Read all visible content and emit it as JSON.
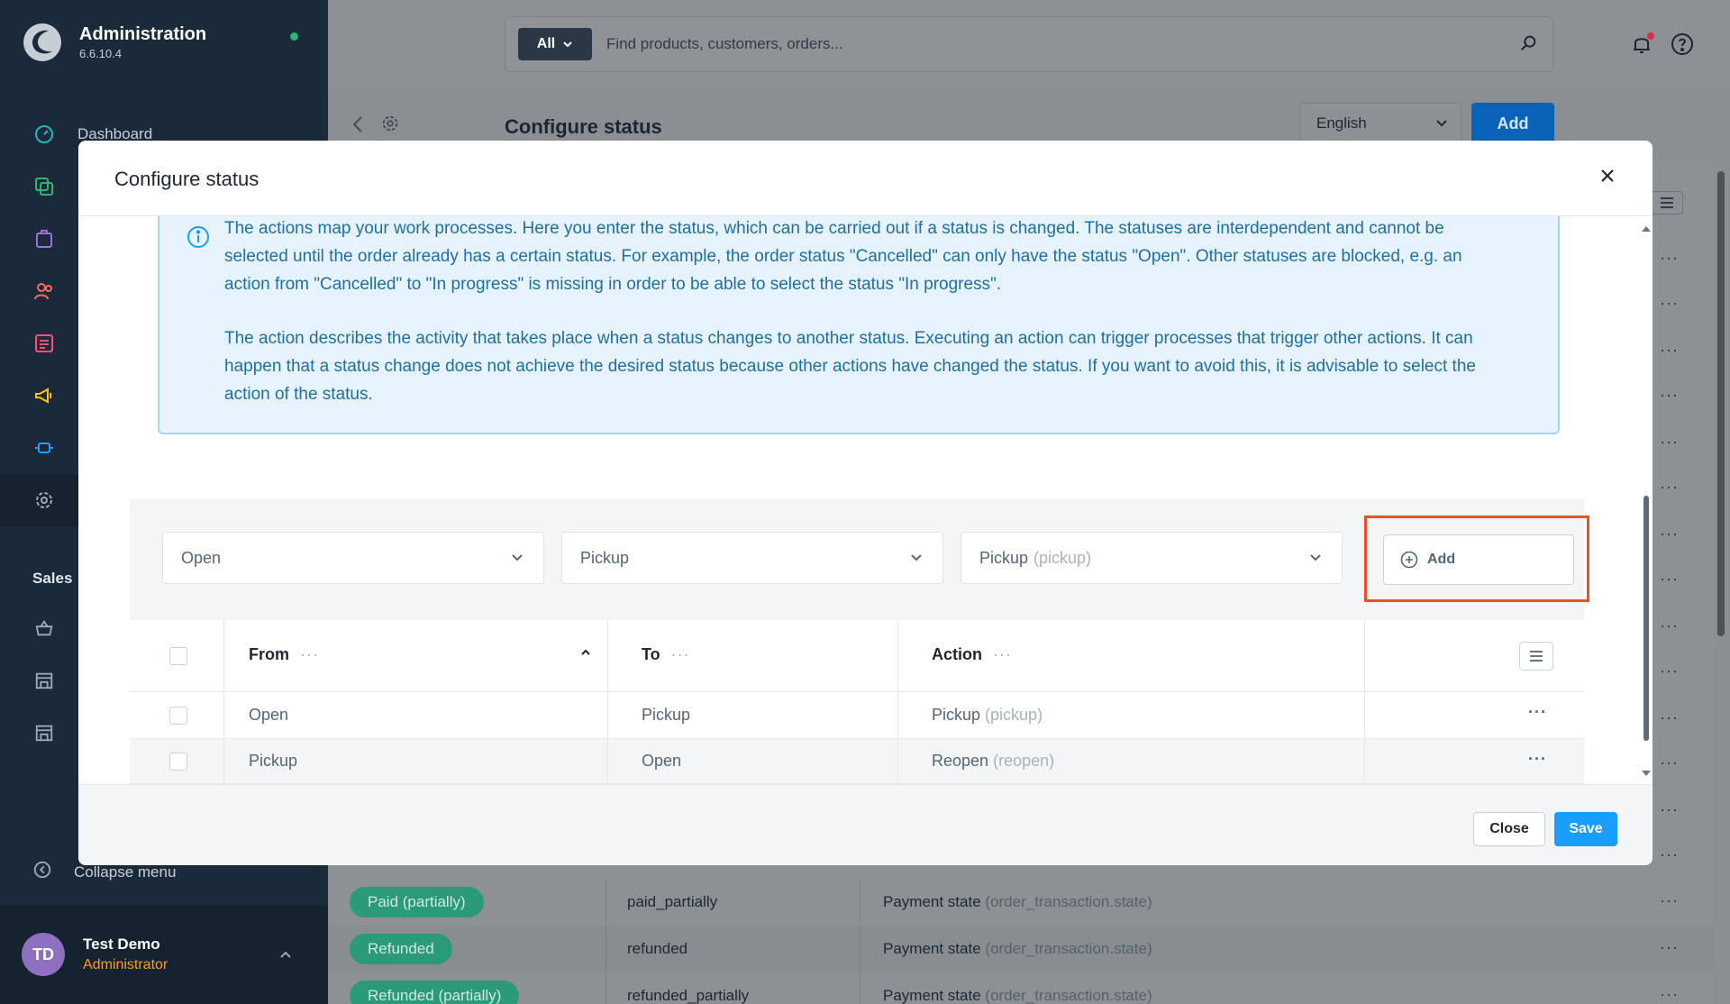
{
  "sidebar": {
    "app_title": "Administration",
    "version": "6.6.10.4",
    "status_color": "#2bb673",
    "nav": [
      {
        "label": "Dashboard",
        "icon": "dashboard-icon"
      },
      {
        "label": "",
        "icon": "catalogues-icon"
      },
      {
        "label": "",
        "icon": "orders-icon"
      },
      {
        "label": "",
        "icon": "customers-icon"
      },
      {
        "label": "",
        "icon": "content-icon"
      },
      {
        "label": "",
        "icon": "marketing-icon"
      },
      {
        "label": "",
        "icon": "extensions-icon"
      },
      {
        "label": "",
        "icon": "settings-icon"
      }
    ],
    "section_label": "Sales",
    "sub_items": [
      {
        "icon": "sales-channel-icon"
      },
      {
        "icon": "storefront-icon"
      },
      {
        "icon": "storefront-icon-2"
      }
    ],
    "collapse_label": "Collapse menu",
    "user": {
      "initials": "TD",
      "name": "Test Demo",
      "role": "Administrator"
    }
  },
  "topbar": {
    "search_scope": "All",
    "search_placeholder": "Find products, customers, orders..."
  },
  "page": {
    "title": "Configure status",
    "language": "English",
    "add_label": "Add",
    "rows": [
      {
        "badge": "Paid (partially)",
        "technical": "paid_partially",
        "machine": "Payment state",
        "machine_key": "(order_transaction.state)"
      },
      {
        "badge": "Refunded",
        "technical": "refunded",
        "machine": "Payment state",
        "machine_key": "(order_transaction.state)"
      },
      {
        "badge": "Refunded (partially)",
        "technical": "refunded_partially",
        "machine": "Payment state",
        "machine_key": "(order_transaction.state)"
      }
    ]
  },
  "modal": {
    "title": "Configure status",
    "info_text_1": "The actions map your work processes. Here you enter the status, which can be carried out if a status is changed. The statuses are interdependent and cannot be selected until the order already has a certain status. For example, the order status \"Cancelled\" can only have the status \"Open\". Other statuses are blocked, e.g. an action from \"Cancelled\" to \"In progress\" is missing in order to be able to select the status \"In progress\".",
    "info_text_2": "The action describes the activity that takes place when a status changes to another status. Executing an action can trigger processes that trigger other actions. It can happen that a status change does not achieve the desired status because other actions have changed the status. If you want to avoid this, it is advisable to select the action of the status.",
    "from_select": "Open",
    "to_select": "Pickup",
    "action_select": "Pickup",
    "action_select_key": "(pickup)",
    "add_label": "Add",
    "columns": {
      "from": "From",
      "to": "To",
      "action": "Action"
    },
    "rows": [
      {
        "from": "Open",
        "to": "Pickup",
        "action": "Pickup",
        "action_key": "(pickup)"
      },
      {
        "from": "Pickup",
        "to": "Open",
        "action": "Reopen",
        "action_key": "(reopen)"
      }
    ],
    "close_label": "Close",
    "save_label": "Save",
    "highlight_color": "#e8541e",
    "primary_color": "#189eff"
  }
}
